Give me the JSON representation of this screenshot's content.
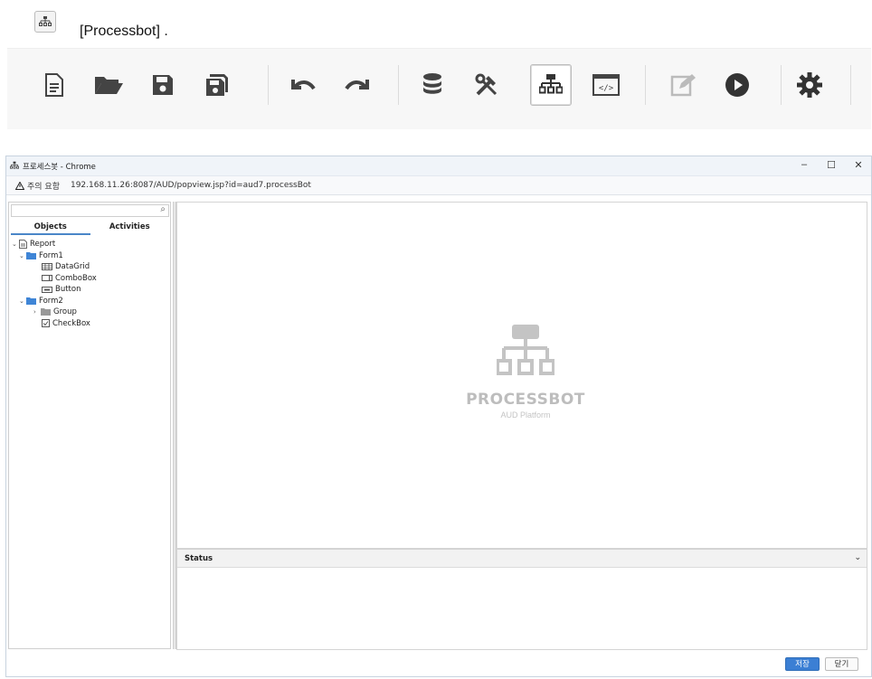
{
  "caption": {
    "icon": "process-diagram-icon",
    "text": "[Processbot] ."
  },
  "toolbar": {
    "items": [
      {
        "icon": "new-document-icon"
      },
      {
        "icon": "open-folder-icon"
      },
      {
        "icon": "save-icon"
      },
      {
        "icon": "save-as-icon"
      },
      {
        "icon": "undo-icon"
      },
      {
        "icon": "redo-icon"
      },
      {
        "icon": "database-icon"
      },
      {
        "icon": "tools-icon"
      },
      {
        "icon": "process-diagram-icon",
        "active": true
      },
      {
        "icon": "code-icon"
      },
      {
        "icon": "edit-icon"
      },
      {
        "icon": "play-icon"
      },
      {
        "icon": "settings-gear-icon"
      }
    ]
  },
  "window": {
    "title": "프로세스봇 - Chrome",
    "security_label": "주의 요함",
    "url": "192.168.11.26:8087/AUD/popview.jsp?id=aud7.processBot",
    "controls": {
      "minimize": "–",
      "maximize": "☐",
      "close": "✕"
    }
  },
  "left_panel": {
    "search_placeholder": "",
    "tabs": [
      {
        "label": "Objects",
        "selected": true
      },
      {
        "label": "Activities",
        "selected": false
      }
    ],
    "tree": [
      {
        "label": "Report",
        "icon": "report-icon",
        "level": 0,
        "expanded": true
      },
      {
        "label": "Form1",
        "icon": "folder-icon",
        "level": 1,
        "expanded": true
      },
      {
        "label": "DataGrid",
        "icon": "datagrid-icon",
        "level": 2
      },
      {
        "label": "ComboBox",
        "icon": "combobox-icon",
        "level": 2
      },
      {
        "label": "Button",
        "icon": "button-icon",
        "level": 2
      },
      {
        "label": "Form2",
        "icon": "folder-icon",
        "level": 1,
        "expanded": true
      },
      {
        "label": "Group",
        "icon": "folder-icon",
        "level": 2,
        "expanded": false
      },
      {
        "label": "CheckBox",
        "icon": "checkbox-icon",
        "level": 2
      }
    ]
  },
  "canvas": {
    "brand": "PROCESSBOT",
    "sub": "AUD Platform"
  },
  "status": {
    "title": "Status"
  },
  "buttons": {
    "save": "저장",
    "close": "닫기"
  },
  "colors": {
    "accent": "#3b7fd4",
    "toolbar_icon": "#444444",
    "disabled_icon": "#bbbbbb"
  }
}
